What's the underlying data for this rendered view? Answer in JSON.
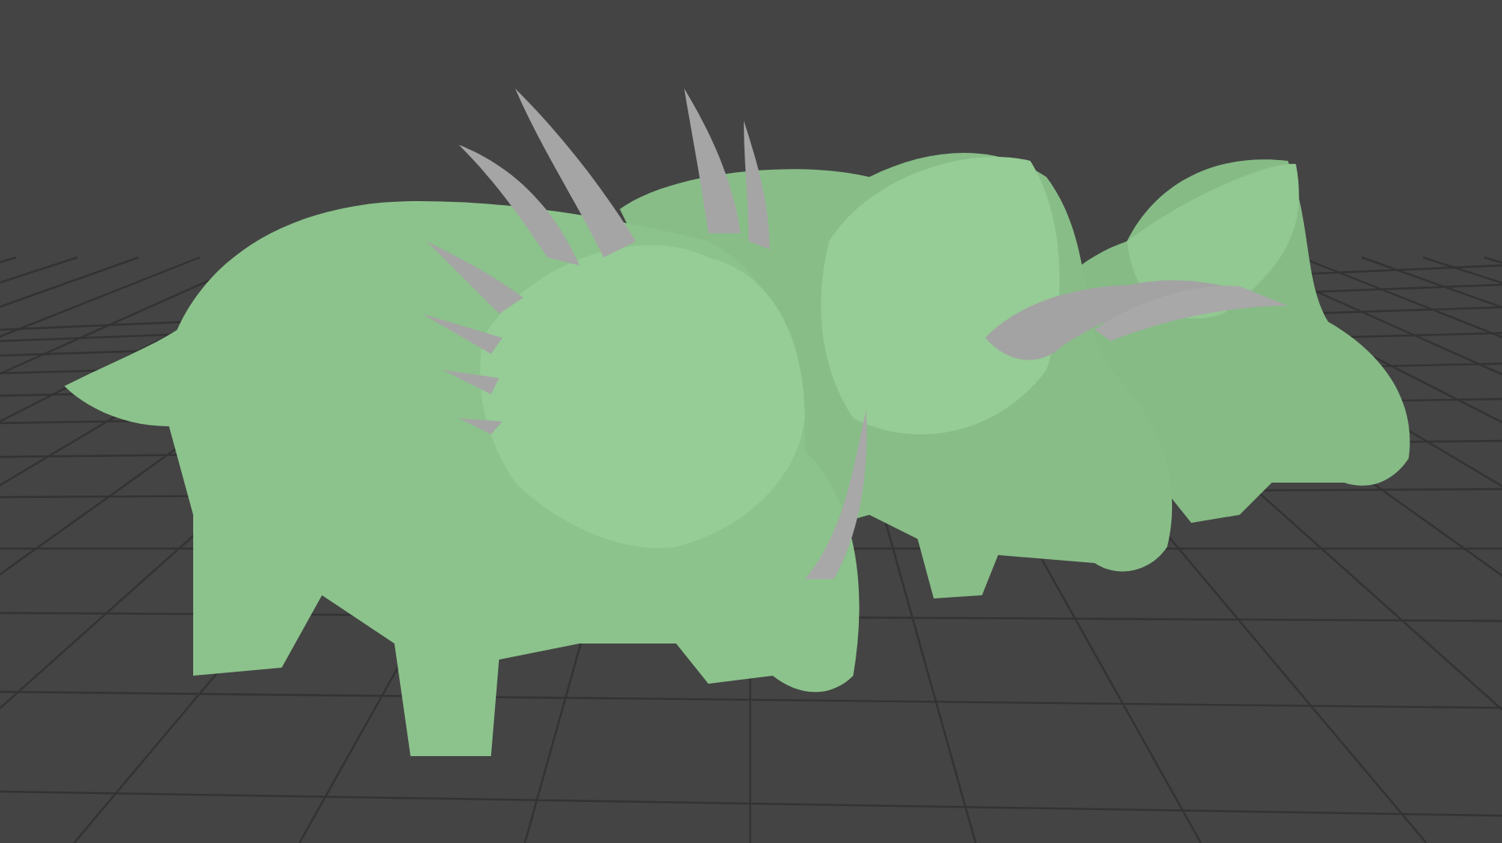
{
  "viewport": {
    "grid_visible": true
  }
}
